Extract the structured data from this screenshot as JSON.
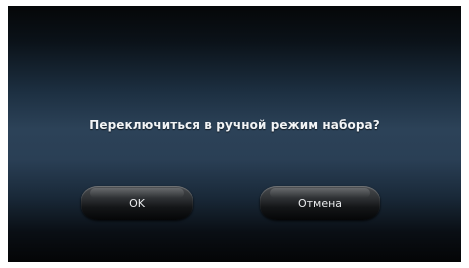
{
  "dialog": {
    "message": "Переключиться в ручной режим набора?",
    "ok_label": "OK",
    "cancel_label": "Отмена"
  },
  "colors": {
    "background_top": "#050708",
    "background_mid": "#2c4258",
    "background_bottom": "#040506",
    "text": "#f2f4f6",
    "button_top": "#4a4d50",
    "button_bottom": "#050607"
  }
}
